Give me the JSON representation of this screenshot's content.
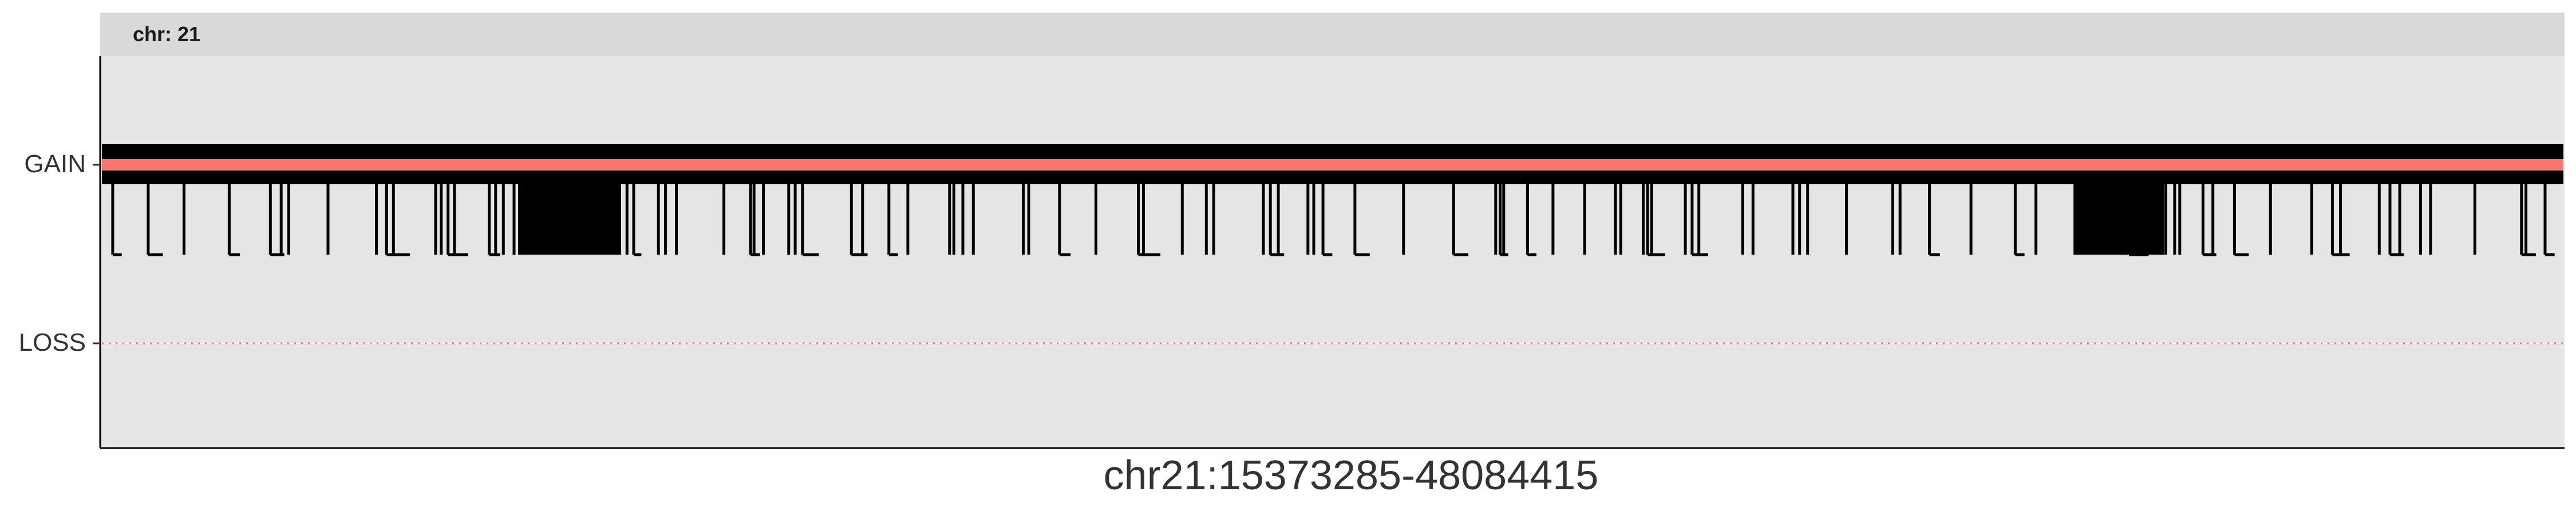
{
  "chart_data": {
    "type": "step",
    "facet_label": "chr: 21",
    "xlabel": "chr21:15373285-48084415",
    "ylabel": "",
    "x_range": [
      15373285,
      48084415
    ],
    "y_categories": [
      "LOSS",
      "GAIN"
    ],
    "grid": true,
    "legend": "none",
    "colors": {
      "panel_bg": "#e5e5e5",
      "strip_bg": "#d9d9d9",
      "step_line": "#000000",
      "gain_segment": "#f8766d",
      "loss_dotted": "#f8766d",
      "axis_text": "#333333"
    },
    "series": [
      {
        "role": "copy-number-segment",
        "state": "GAIN",
        "x_start": 15373285,
        "x_end": 48084415
      },
      {
        "role": "reference-line",
        "state": "LOSS",
        "x_start": 15373285,
        "x_end": 48084415,
        "style": "dotted"
      }
    ]
  }
}
